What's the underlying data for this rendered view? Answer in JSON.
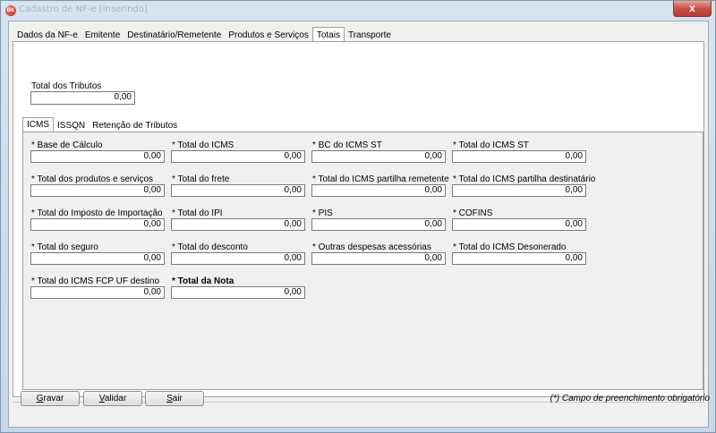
{
  "window": {
    "title": "Cadastro de NF-e [Inserindo]",
    "icon_letters": "BK",
    "close_glyph": "x"
  },
  "tabs": [
    "Dados da NF-e",
    "Emitente",
    "Destinatário/Remetente",
    "Produtos e Serviços",
    "Totais",
    "Transporte"
  ],
  "active_tab": "Totais",
  "total_tributos": {
    "label": "Total dos Tributos",
    "value": "0,00"
  },
  "subtabs": [
    "ICMS",
    "ISSQN",
    "Retenção de Tributos"
  ],
  "active_subtab": "ICMS",
  "fields": {
    "base_calculo": {
      "label": "* Base de Cálculo",
      "value": "0,00"
    },
    "total_icms": {
      "label": "* Total do ICMS",
      "value": "0,00"
    },
    "bc_icms_st": {
      "label": "* BC do ICMS ST",
      "value": "0,00"
    },
    "total_icms_st": {
      "label": "* Total do ICMS ST",
      "value": "0,00"
    },
    "total_produtos": {
      "label": "* Total dos produtos e serviços",
      "value": "0,00"
    },
    "total_frete": {
      "label": "* Total do frete",
      "value": "0,00"
    },
    "icms_partilha_remetente": {
      "label": "* Total do ICMS partilha remetente",
      "value": "0,00"
    },
    "icms_partilha_destinatario": {
      "label": "* Total do ICMS partilha destinatário",
      "value": "0,00"
    },
    "imposto_importacao": {
      "label": "* Total do Imposto de Importação",
      "value": "0,00"
    },
    "total_ipi": {
      "label": "* Total do IPI",
      "value": "0,00"
    },
    "pis": {
      "label": "* PIS",
      "value": "0,00"
    },
    "cofins": {
      "label": "* COFINS",
      "value": "0,00"
    },
    "total_seguro": {
      "label": "* Total do seguro",
      "value": "0,00"
    },
    "total_desconto": {
      "label": "* Total do desconto",
      "value": "0,00"
    },
    "outras_despesas": {
      "label": "* Outras despesas acessórias",
      "value": "0,00"
    },
    "icms_desonerado": {
      "label": "* Total do ICMS Desonerado",
      "value": "0,00"
    },
    "icms_fcp_uf_destino": {
      "label": "* Total do ICMS FCP UF destino",
      "value": "0,00"
    },
    "total_nota": {
      "label": "* Total da Nota",
      "value": "0,00"
    }
  },
  "buttons": {
    "gravar": {
      "first": "G",
      "rest": "ravar"
    },
    "validar": {
      "first": "V",
      "rest": "alidar"
    },
    "sair": {
      "first": "S",
      "rest": "air"
    }
  },
  "hint": "(*) Campo de preenchimento obrigatório"
}
